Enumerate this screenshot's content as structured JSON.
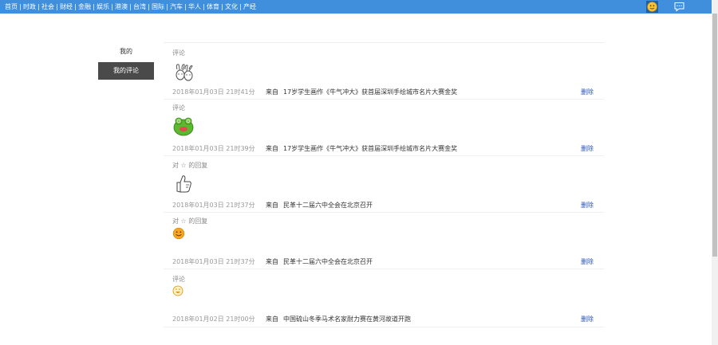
{
  "nav": {
    "items": [
      "首页",
      "时政",
      "社会",
      "财经",
      "金融",
      "娱乐",
      "港澳",
      "台湾",
      "国际",
      "汽车",
      "华人",
      "体育",
      "文化",
      "产经"
    ]
  },
  "sidebar": {
    "title": "我的",
    "items": [
      {
        "label": "我的评论"
      }
    ]
  },
  "comments": [
    {
      "type": "评论",
      "emoji": "rabbit-sketch",
      "time": "2018年01月03日 21时41分",
      "source_label": "来自",
      "source_title": "17岁学生画作《牛气冲大》获首届深圳手绘城市名片大赛金奖",
      "delete_label": "删除"
    },
    {
      "type": "评论",
      "emoji": "green-frog",
      "time": "2018年01月03日 21时39分",
      "source_label": "来自",
      "source_title": "17岁学生画作《牛气冲大》获首届深圳手绘城市名片大赛金奖",
      "delete_label": "删除"
    },
    {
      "type": "对 ☆ 的回复",
      "emoji": "thumbs-sketch",
      "time": "2018年01月03日 21时37分",
      "source_label": "来自",
      "source_title": "民革十二届六中全会在北京召开",
      "delete_label": "删除"
    },
    {
      "type": "对 ☆ 的回复",
      "emoji": "orange-smiley",
      "time": "2018年01月03日 21时37分",
      "source_label": "来自",
      "source_title": "民革十二届六中全会在北京召开",
      "delete_label": "删除"
    },
    {
      "type": "评论",
      "emoji": "laughing-smiley",
      "time": "2018年01月02日 21时00分",
      "source_label": "来自",
      "source_title": "中国硫山冬季马术名家耐力赛在黄河故道开跑",
      "delete_label": "删除"
    }
  ],
  "colors": {
    "nav_bg": "#3f8fdd",
    "sidebar_active": "#4a4a4a",
    "link": "#2a55b8"
  }
}
